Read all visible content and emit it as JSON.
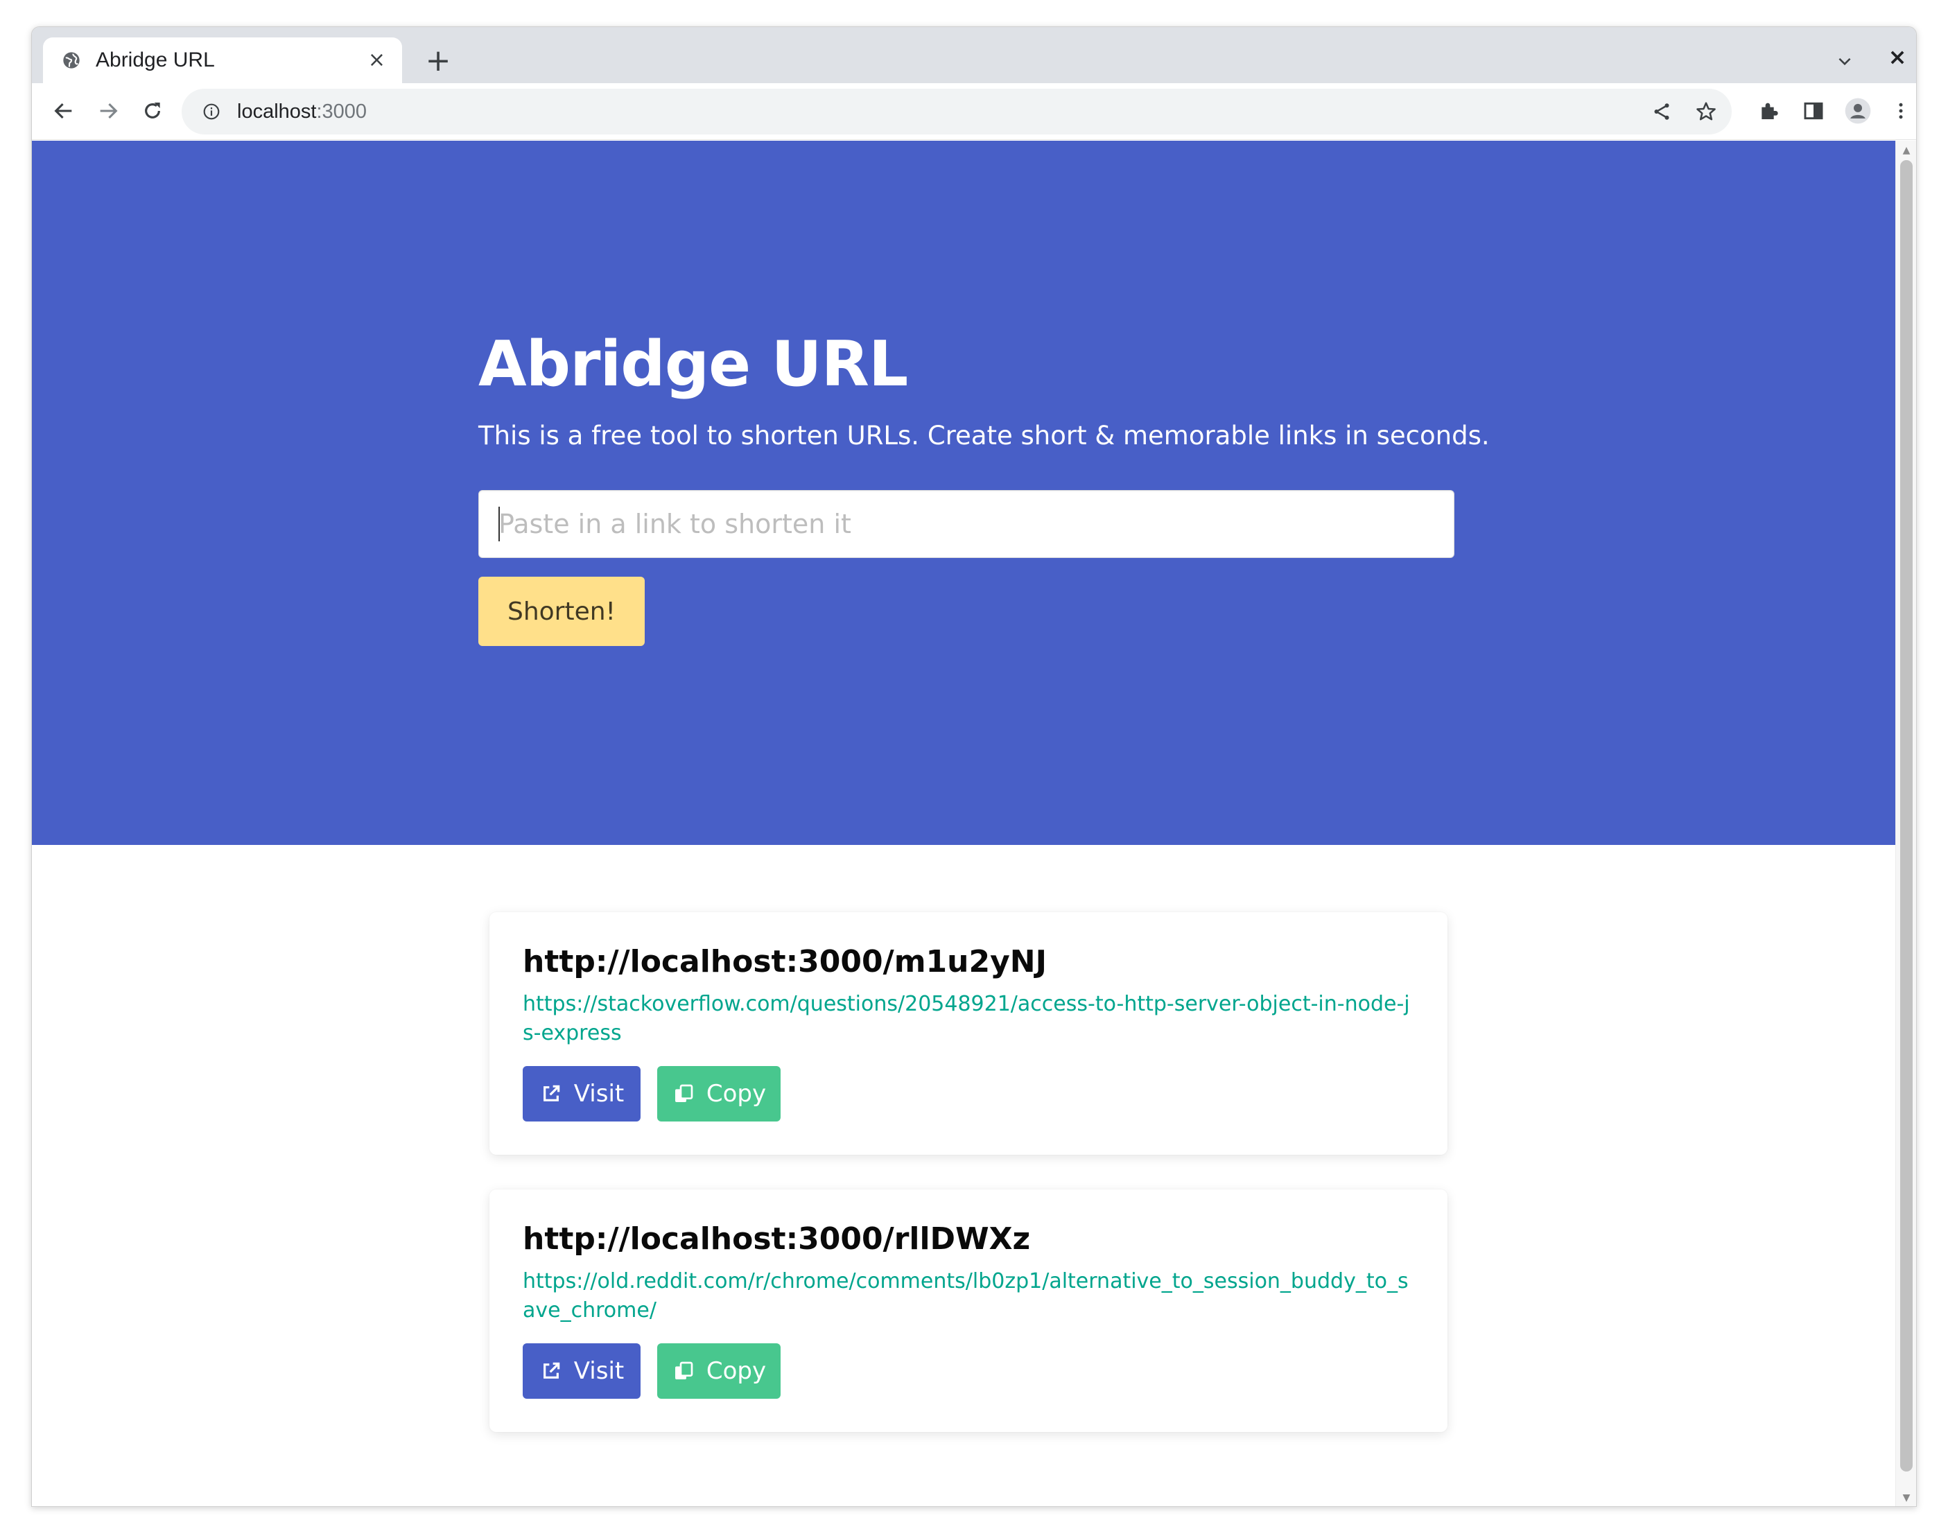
{
  "browser": {
    "tab": {
      "title": "Abridge URL",
      "favicon": "globe-icon",
      "close_glyph": "×"
    },
    "new_tab_glyph": "+",
    "window_close_glyph": "×",
    "address_bar": {
      "host": "localhost",
      "port": ":3000"
    },
    "toolbar_icons": [
      "back-icon",
      "forward-icon",
      "reload-icon",
      "info-icon",
      "share-icon",
      "star-icon",
      "extensions-icon",
      "side-panel-icon",
      "profile-icon",
      "menu-icon"
    ]
  },
  "hero": {
    "title": "Abridge URL",
    "subtitle": "This is a free tool to shorten URLs. Create short & memorable links in seconds.",
    "input_placeholder": "Paste in a link to shorten it",
    "input_value": "",
    "shorten_label": "Shorten!",
    "background_color": "#485fc7",
    "button_color": "#ffe08a"
  },
  "links": [
    {
      "short_url": "http://localhost:3000/m1u2yNJ",
      "original_url": "https://stackoverflow.com/questions/20548921/access-to-http-server-object-in-node-js-express",
      "visit_label": "Visit",
      "copy_label": "Copy"
    },
    {
      "short_url": "http://localhost:3000/rllDWXz",
      "original_url": "https://old.reddit.com/r/chrome/comments/lb0zp1/alternative_to_session_buddy_to_save_chrome/",
      "visit_label": "Visit",
      "copy_label": "Copy"
    }
  ],
  "colors": {
    "visit_button": "#485fc7",
    "copy_button": "#48c78e",
    "link_text": "#00a58d"
  }
}
